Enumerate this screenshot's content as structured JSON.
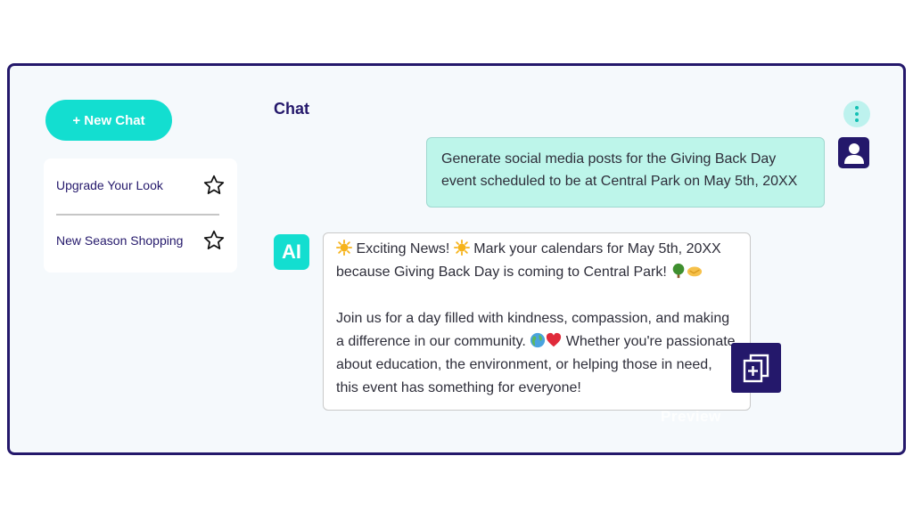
{
  "sidebar": {
    "new_chat_label": "+ New Chat",
    "favorites": [
      {
        "label": "Upgrade Your Look",
        "icon": "star-icon"
      },
      {
        "label": "New Season Shopping",
        "icon": "star-icon"
      }
    ]
  },
  "main": {
    "title": "Chat",
    "more_icon": "more-vertical-icon",
    "user_avatar_icon": "user-icon",
    "user_message": "Generate social media posts for the Giving Back Day event scheduled to be at Central Park on May 5th, 20XX",
    "ai_avatar_label": "AI",
    "ai_message": {
      "part1": " Exciting News! ",
      "part2": " Mark your calendars for May 5th, 20XX because Giving Back Day is coming to Central Park! ",
      "part3": "Join us for a day filled with kindness, compassion, and making a difference in our community. ",
      "part4": " Whether you're passionate about education, the environment, or helping those in need, this event has something for everyone!"
    },
    "copy_icon": "copy-add-icon",
    "watermark": "Preview"
  },
  "colors": {
    "brand_dark": "#24186b",
    "accent_teal": "#13ded0",
    "user_bubble": "#bdf5ea",
    "panel_bg": "#f5f9fc"
  }
}
